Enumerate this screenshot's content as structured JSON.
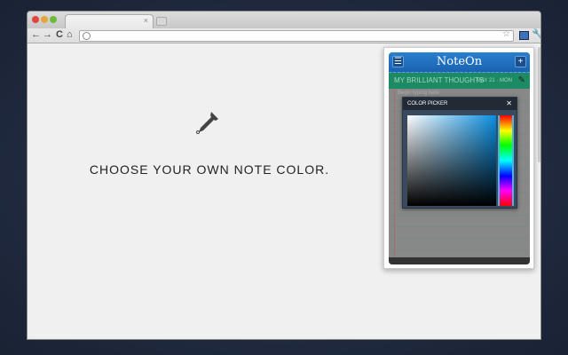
{
  "browser": {
    "tab_close": "×",
    "back": "←",
    "forward": "→",
    "reload": "C",
    "home": "⌂",
    "star": "☆",
    "wrench": "🔧"
  },
  "page": {
    "headline": "CHOOSE YOUR OWN NOTE COLOR."
  },
  "noteon": {
    "title": "NoteOn",
    "menu": "☰",
    "add": "+",
    "note_title": "MY BRILLIANT THOUGHTS",
    "date": "MAY 21 · MON",
    "placeholder": "Begin typing here",
    "pen": "✎"
  },
  "color_picker": {
    "title": "COLOR PICKER",
    "close": "✕"
  },
  "colors": {
    "header": "#1a62b0",
    "green": "#1c8a62"
  }
}
